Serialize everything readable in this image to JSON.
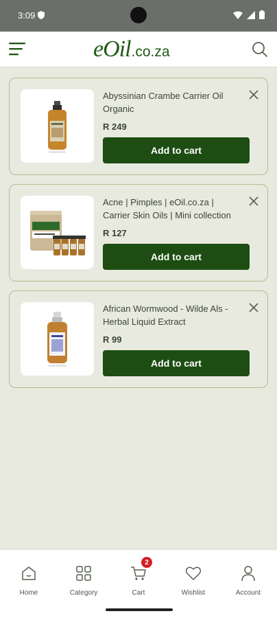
{
  "status_bar": {
    "time": "3:09"
  },
  "header": {
    "logo_main": "eOil",
    "logo_domain": ".co.za"
  },
  "cart_items": [
    {
      "title": "Abyssinian Crambe Carrier Oil Organic",
      "price": "R 249",
      "button": "Add to cart",
      "image": "amber-bottle-icon"
    },
    {
      "title": "Acne | Pimples | eOil.co.za | Carrier Skin Oils | Mini collection",
      "price": "R 127",
      "button": "Add to cart",
      "image": "jar-and-bottles-icon"
    },
    {
      "title": "African Wormwood - Wilde Als - Herbal Liquid Extract",
      "price": "R 99",
      "button": "Add to cart",
      "image": "amber-bottle-icon"
    }
  ],
  "bottom_nav": {
    "items": [
      {
        "label": "Home",
        "icon": "home-icon"
      },
      {
        "label": "Category",
        "icon": "grid-icon"
      },
      {
        "label": "Cart",
        "icon": "cart-icon",
        "badge": "2"
      },
      {
        "label": "Wishlist",
        "icon": "heart-icon"
      },
      {
        "label": "Account",
        "icon": "person-icon"
      }
    ]
  },
  "colors": {
    "brand_green": "#1d4d12",
    "background": "#e8eadf",
    "badge_red": "#d22026"
  }
}
